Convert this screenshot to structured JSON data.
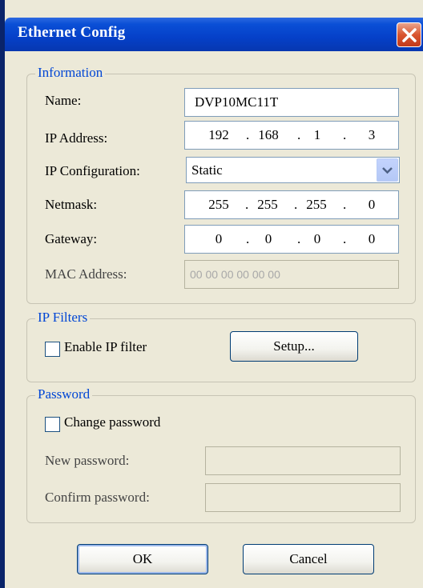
{
  "window": {
    "title": "Ethernet Config"
  },
  "information": {
    "title": "Information",
    "name_label": "Name:",
    "name_value": "DVP10MC11T",
    "ip_label": "IP Address:",
    "ip": [
      "192",
      "168",
      "1",
      "3"
    ],
    "ipconfig_label": "IP Configuration:",
    "ipconfig_value": "Static",
    "netmask_label": "Netmask:",
    "netmask": [
      "255",
      "255",
      "255",
      "0"
    ],
    "gateway_label": "Gateway:",
    "gateway": [
      "0",
      "0",
      "0",
      "0"
    ],
    "mac_label": "MAC Address:",
    "mac_value": "00 00 00 00 00 00"
  },
  "ipfilters": {
    "title": "IP Filters",
    "enable_label": "Enable IP filter",
    "setup_label": "Setup..."
  },
  "password": {
    "title": "Password",
    "change_label": "Change password",
    "new_label": "New password:",
    "confirm_label": "Confirm password:"
  },
  "buttons": {
    "ok": "OK",
    "cancel": "Cancel"
  }
}
